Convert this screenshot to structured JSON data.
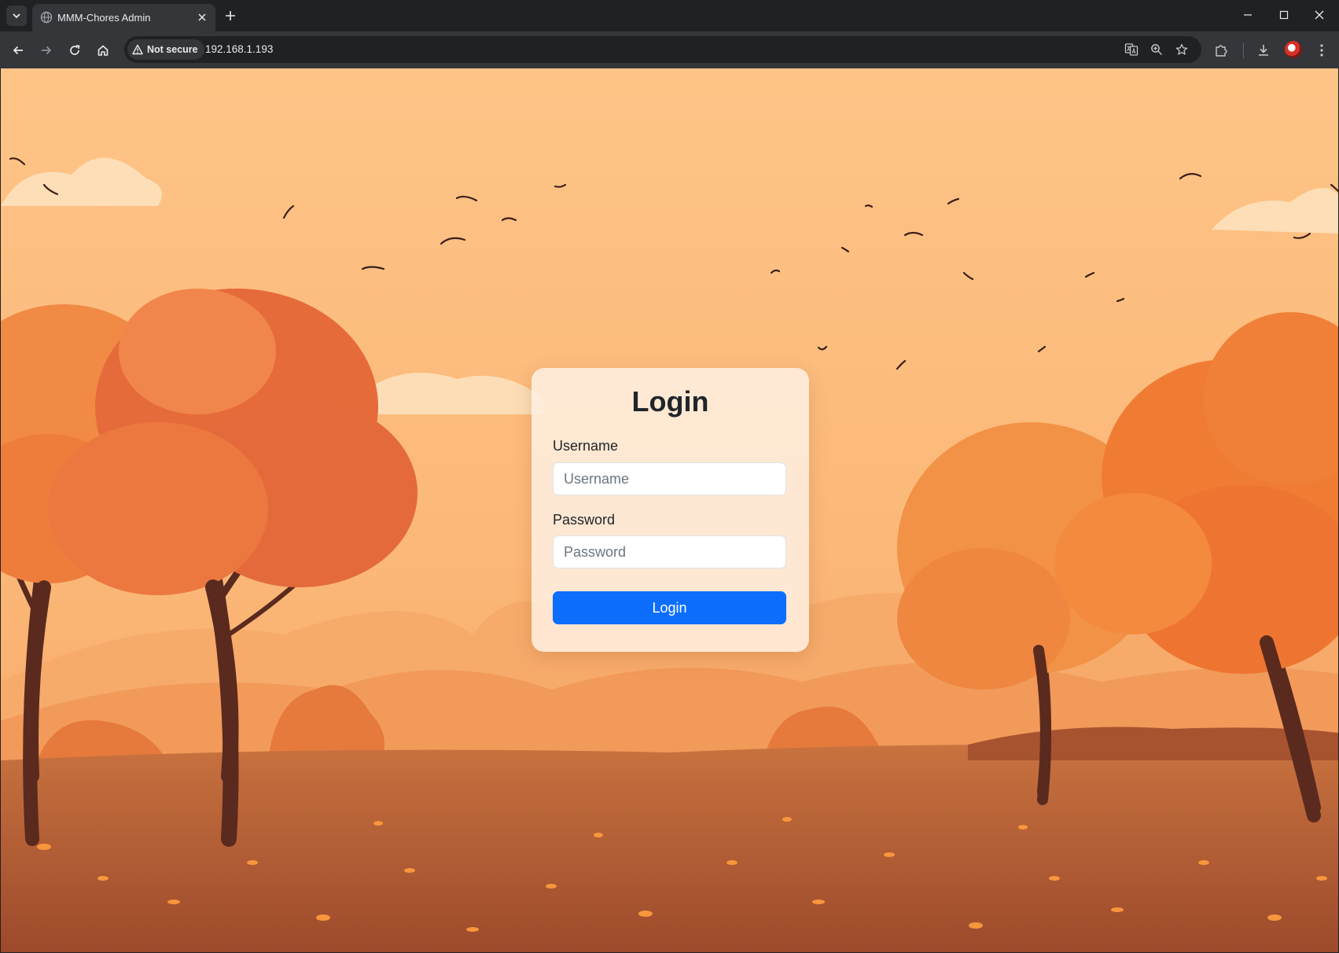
{
  "browser": {
    "tab": {
      "title": "MMM-Chores Admin"
    },
    "omnibox": {
      "security_label": "Not secure",
      "url": "192.168.1.193"
    },
    "theme": {
      "frame": "#202124",
      "toolbar": "#35363a",
      "text": "#e8eaed",
      "icon": "#c4c7c5"
    }
  },
  "login": {
    "title": "Login",
    "username": {
      "label": "Username",
      "placeholder": "Username",
      "value": ""
    },
    "password": {
      "label": "Password",
      "placeholder": "Password",
      "value": ""
    },
    "submit_label": "Login",
    "button_color": "#0d6efd"
  },
  "background": {
    "sky_color": "#fec487",
    "foliage_color": "#ee7a36",
    "ground_color": "#b9623a"
  }
}
